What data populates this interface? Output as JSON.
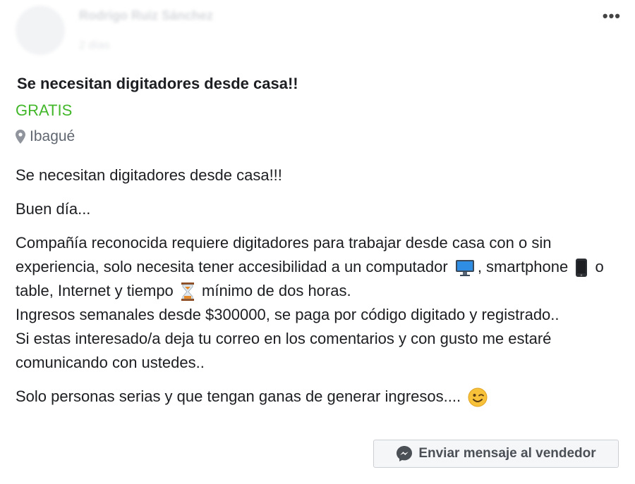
{
  "header": {
    "poster_name": "Rodrigo Ruiz Sánchez",
    "post_time": "2 días",
    "more_label": "•••"
  },
  "listing": {
    "title": "Se necesitan digitadores desde casa!!",
    "price": "GRATIS",
    "location": "Ibagué"
  },
  "description": {
    "p1": "Se necesitan digitadores desde casa!!!",
    "p2": "Buen día...",
    "p3_a": "Compañía reconocida requiere digitadores para trabajar desde casa con o sin experiencia, solo necesita tener accesibilidad a un computador",
    "p3_b": ", smartphone",
    "p3_c": "o table, Internet y tiempo",
    "p3_d": "mínimo de dos horas.",
    "p3_e": "Ingresos semanales desde $300000, se paga por código digitado y registrado..",
    "p3_f": "Si estas interesado/a deja tu correo en los comentarios y con gusto me estaré comunicando con ustedes..",
    "p4": "Solo personas serias y que tengan ganas de generar ingresos....",
    "icons": [
      "computer-monitor-icon",
      "smartphone-icon",
      "hourglass-icon",
      "winking-face-icon"
    ]
  },
  "actions": {
    "message_label": "Enviar mensaje al vendedor"
  },
  "colors": {
    "price": "#42b72a",
    "location": "#606770",
    "button_bg": "#f5f6f7",
    "text": "#1c1e21"
  }
}
